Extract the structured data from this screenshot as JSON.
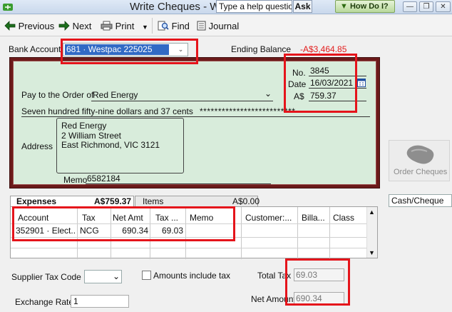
{
  "window": {
    "title": "Write Cheques - W",
    "help_placeholder": "Type a help question",
    "ask_label": "Ask",
    "howdoi_label": "How Do I?"
  },
  "toolbar": {
    "previous_label": "Previous",
    "next_label": "Next",
    "print_label": "Print",
    "find_label": "Find",
    "journal_label": "Journal"
  },
  "account": {
    "bank_account_label": "Bank Account",
    "bank_account_value": "681 · Westpac 225025",
    "ending_balance_label": "Ending Balance",
    "ending_balance_value": "-A$3,464.85"
  },
  "cheque": {
    "no_label": "No.",
    "no_value": "3845",
    "date_label": "Date",
    "date_value": "16/03/2021",
    "amount_label": "A$",
    "amount_value": "759.37",
    "pay_to_label": "Pay to the Order of",
    "pay_to_value": "Red Energy",
    "amount_words": "Seven hundred fifty-nine dollars and 37 cents",
    "amount_words_fill": "**************************",
    "address_label": "Address",
    "address_lines": [
      "Red Energy",
      "2 William Street",
      "East Richmond, VIC 3121"
    ],
    "memo_label": "Memo",
    "memo_value": "6582184"
  },
  "side": {
    "order_cheques_label": "Order Cheques",
    "payment_method": "Cash/Cheque"
  },
  "tabs": [
    {
      "label": "Expenses",
      "amount": "A$759.37"
    },
    {
      "label": "Items",
      "amount": "A$0.00"
    }
  ],
  "grid": {
    "columns": [
      "Account",
      "Tax",
      "Net Amt",
      "Tax ...",
      "Memo",
      "Customer:...",
      "Billa...",
      "Class"
    ],
    "rows": [
      [
        "352901 · Elect...",
        "NCG",
        "690.34",
        "69.03",
        "",
        "",
        "",
        ""
      ]
    ]
  },
  "footer": {
    "supplier_tax_code_label": "Supplier Tax Code",
    "amounts_include_tax_label": "Amounts include tax",
    "exchange_rate_label": "Exchange Rate",
    "exchange_rate_value": "1",
    "total_tax_label": "Total Tax",
    "total_tax_value": "69.03",
    "net_amount_label": "Net Amount",
    "net_amount_value": "690.34"
  },
  "colors": {
    "cheque_bg": "#d8ecdb",
    "cheque_border": "#6b1a1a",
    "highlight": "#e5141b",
    "ending_balance": "#e21b1b"
  }
}
